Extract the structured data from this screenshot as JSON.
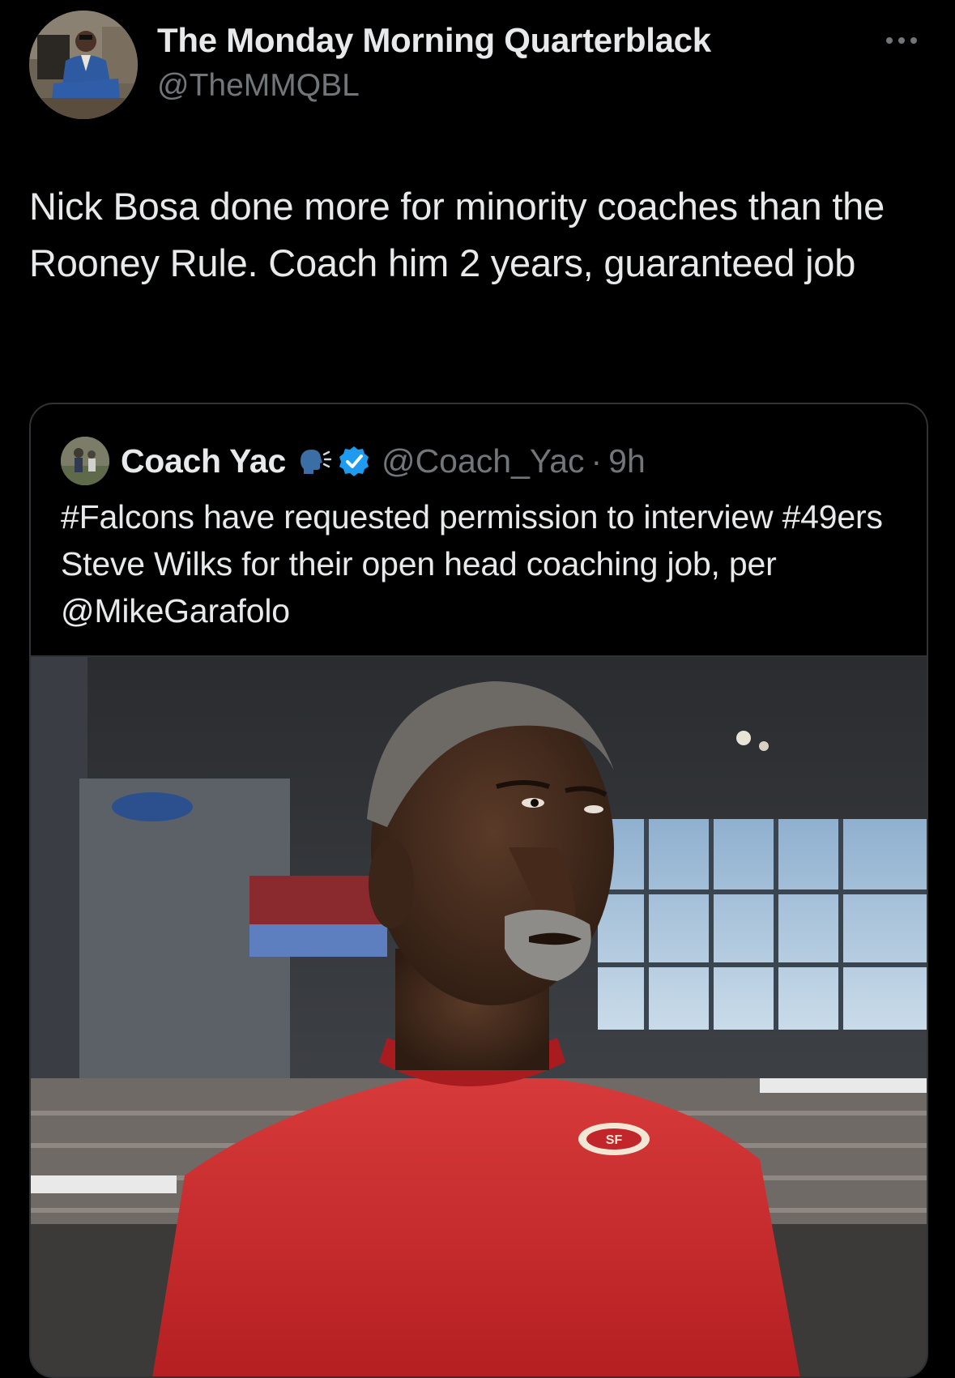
{
  "author": {
    "name": "The Monday Morning Quarterblack",
    "handle": "@TheMMQBL",
    "avatar_icon": "profile-photo-man-in-blue-suit"
  },
  "more_icon": "ellipsis-icon",
  "tweet": {
    "text": "Nick Bosa done more for minority coaches than the Rooney Rule. Coach him 2 years, guaranteed job"
  },
  "quoted_tweet": {
    "name": "Coach Yac",
    "emoji_icon": "speaking-head-emoji",
    "verified_icon": "verified-badge-icon",
    "verified_color": "#1d9bf0",
    "handle": "@Coach_Yac",
    "separator": "·",
    "time": "9h",
    "text": "#Falcons have requested permission to interview #49ers Steve Wilks for their open head coaching job, per @MikeGarafolo",
    "media_icon": "photo-coach-in-red-49ers-shirt-in-stadium"
  },
  "colors": {
    "background": "#000000",
    "text_primary": "#e7e9ea",
    "text_secondary": "#71767b",
    "border": "#2f3336",
    "shirt_red": "#c8282b"
  }
}
